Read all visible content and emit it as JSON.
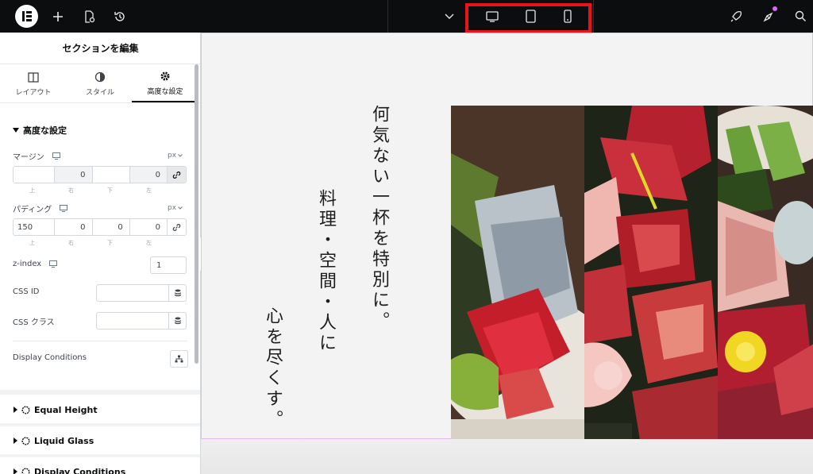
{
  "topbar": {
    "icons": [
      "elementor-logo-icon",
      "plus-icon",
      "page-settings-icon",
      "history-icon",
      "chevron-down-icon",
      "desktop-icon",
      "tablet-icon",
      "mobile-icon",
      "rocket-icon",
      "notifications-icon",
      "search-icon"
    ]
  },
  "panel": {
    "title": "セクションを編集",
    "tabs": [
      {
        "label": "レイアウト",
        "icon": "columns-icon"
      },
      {
        "label": "スタイル",
        "icon": "half-circle-icon"
      },
      {
        "label": "高度な設定",
        "icon": "gear-icon"
      }
    ],
    "advanced": {
      "heading": "高度な設定",
      "margin": {
        "label": "マージン",
        "unit": "px",
        "values": [
          "",
          "0",
          "",
          "0"
        ]
      },
      "padding": {
        "label": "パディング",
        "unit": "px",
        "values": [
          "150",
          "0",
          "0",
          "0"
        ]
      },
      "sides": [
        "上",
        "右",
        "下",
        "左"
      ],
      "zindex": {
        "label": "z-index",
        "value": "1"
      },
      "css_id": {
        "label": "CSS ID",
        "value": ""
      },
      "css_class": {
        "label": "CSS クラス",
        "value": ""
      },
      "display_conditions": {
        "label": "Display Conditions"
      }
    },
    "collapsed_sections": [
      "Equal Height",
      "Liquid Glass",
      "Display Conditions"
    ]
  },
  "canvas": {
    "text_col1": "何気ない一杯を特別に。",
    "text_col2": "料理・空間・人に",
    "text_col3": "心を尽くす。",
    "photos": [
      "sashimi-photo",
      "wagyu-photo",
      "chicken-sashimi-photo"
    ]
  },
  "colors": {
    "topbar": "#0c0d0e",
    "highlight": "#e8131b",
    "section_outline": "#e6b9f0"
  }
}
